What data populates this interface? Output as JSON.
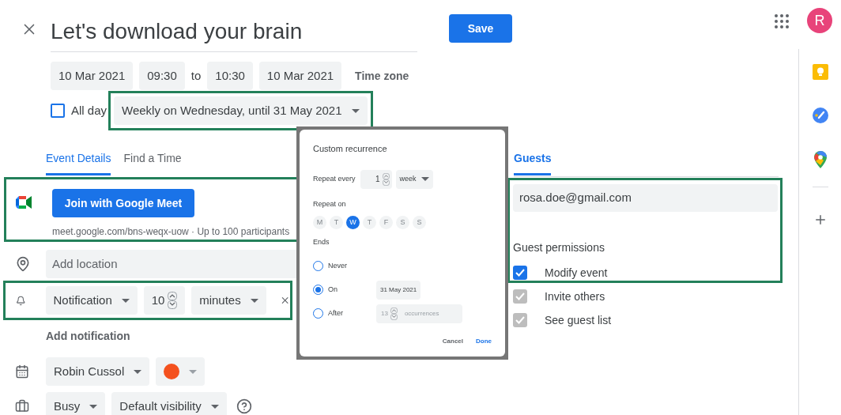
{
  "header": {
    "title": "Let's download your brain",
    "save": "Save",
    "avatar": "R"
  },
  "dates": {
    "start_date": "10 Mar 2021",
    "start_time": "09:30",
    "to": "to",
    "end_time": "10:30",
    "end_date": "10 Mar 2021",
    "time_zone": "Time zone"
  },
  "all_day": {
    "label": "All day",
    "checked": false
  },
  "recurrence": {
    "value": "Weekly on Wednesday, until 31 May 2021",
    "highlighted": true
  },
  "tabs": [
    {
      "label": "Event Details",
      "selected": true
    },
    {
      "label": "Find a Time",
      "selected": false
    }
  ],
  "meet": {
    "button": "Join with Google Meet",
    "info": "meet.google.com/bns-weqx-uow · Up to 100 participants",
    "highlighted": true
  },
  "location": {
    "placeholder": "Add location"
  },
  "notification": {
    "type": "Notification",
    "value": "10",
    "unit": "minutes",
    "highlighted": true
  },
  "add_notification": "Add notification",
  "calendar": {
    "owner": "Robin Cussol",
    "color": "#f4511e"
  },
  "availability": {
    "status": "Busy",
    "visibility": "Default visibility"
  },
  "guests": {
    "tab": {
      "label": "Guests",
      "selected": true
    },
    "email": "rosa.doe@gmail.com",
    "highlighted": true,
    "permissions_title": "Guest permissions",
    "permissions": [
      {
        "label": "Modify event",
        "checked": true,
        "disabled": false
      },
      {
        "label": "Invite others",
        "checked": true,
        "disabled": true
      },
      {
        "label": "See guest list",
        "checked": true,
        "disabled": true
      }
    ]
  },
  "dialog": {
    "title": "Custom recurrence",
    "repeat_every_label": "Repeat every",
    "interval": "1",
    "unit": "week",
    "repeat_on_label": "Repeat on",
    "days": [
      {
        "label": "M",
        "selected": false
      },
      {
        "label": "T",
        "selected": false
      },
      {
        "label": "W",
        "selected": true
      },
      {
        "label": "T",
        "selected": false
      },
      {
        "label": "F",
        "selected": false
      },
      {
        "label": "S",
        "selected": false
      },
      {
        "label": "S",
        "selected": false
      }
    ],
    "ends_label": "Ends",
    "ends_options": [
      {
        "kind": "plain",
        "label": "Never",
        "selected": false
      },
      {
        "kind": "date",
        "label": "On",
        "selected": true,
        "value": "31 May 2021"
      },
      {
        "kind": "count",
        "label": "After",
        "selected": false,
        "disabled": true,
        "value": "13",
        "suffix": "occurrences"
      }
    ],
    "cancel": "Cancel",
    "done": "Done"
  }
}
